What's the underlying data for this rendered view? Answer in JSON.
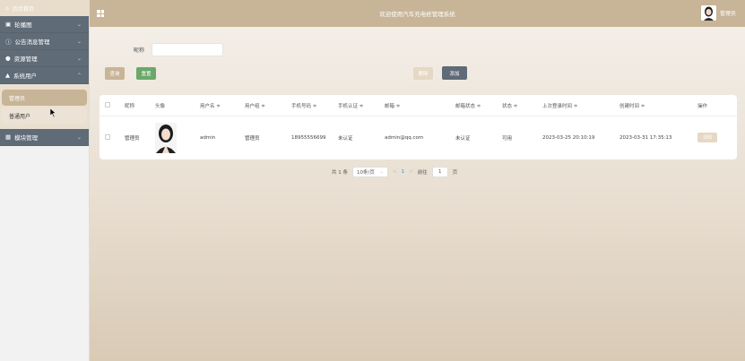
{
  "sidebar": {
    "home_label": "后台首页",
    "items": [
      {
        "label": "轮播图",
        "icon": "image-icon",
        "chevron": "⌄"
      },
      {
        "label": "公告消息管理",
        "icon": "info-circle-icon",
        "chevron": "⌄"
      },
      {
        "label": "资源管理",
        "icon": "location-pin-icon",
        "chevron": "⌄"
      },
      {
        "label": "系统用户",
        "icon": "user-icon",
        "chevron": "⌃"
      }
    ],
    "sub_items": [
      {
        "label": "管理员",
        "active": true
      },
      {
        "label": "普通用户",
        "active": false
      }
    ],
    "module": {
      "label": "模块管理",
      "icon": "grid-icon",
      "chevron": "⌄"
    }
  },
  "header": {
    "title": "欢迎使用汽车充电桩管理系统",
    "user_name": "管理员"
  },
  "search": {
    "label": "昵称",
    "value": "",
    "placeholder": ""
  },
  "buttons": {
    "query": "查询",
    "reset": "重置",
    "delete": "删除",
    "add": "添加"
  },
  "table": {
    "columns": [
      "",
      "昵称",
      "头像",
      "用户名 ≑",
      "用户组 ≑",
      "手机号码 ≑",
      "手机认证 ≑",
      "邮箱 ≑",
      "邮箱状态 ≑",
      "状态 ≑",
      "上次登录时间 ≑",
      "创建时间 ≑",
      "操作"
    ],
    "rows": [
      {
        "nickname": "管理员",
        "username": "admin",
        "group": "管理员",
        "phone": "18955556699",
        "phone_verified": "未认证",
        "email": "admin@qq.com",
        "email_status": "未认证",
        "status": "可用",
        "last_login": "2023-03-25 20:10:19",
        "created": "2023-03-31 17:35:13",
        "action": "详情"
      }
    ]
  },
  "pagination": {
    "total": "共 1 条",
    "page_size": "10条/页",
    "prev": "<",
    "current": "1",
    "next": ">",
    "goto_label": "前往",
    "goto_value": "1",
    "page_unit": "页"
  },
  "colors": {
    "brand": "#c8b497",
    "sidebar_menu": "#5f6b76",
    "success": "#6aa86a"
  }
}
